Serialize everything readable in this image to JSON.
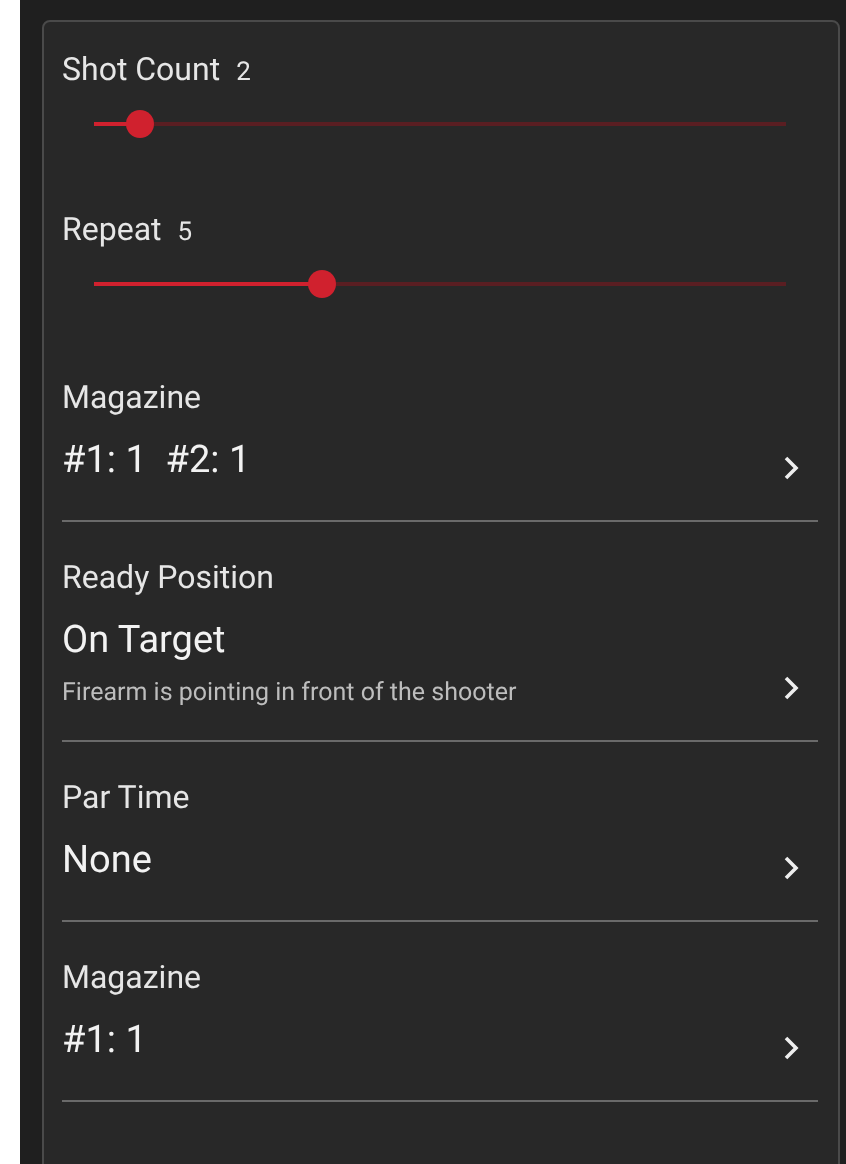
{
  "settings": [
    {
      "kind": "slider",
      "label": "Shot Count",
      "reading": "2",
      "level": 0.066
    },
    {
      "kind": "slider",
      "label": "Repeat",
      "reading": "5",
      "level": 0.33
    },
    {
      "kind": "select",
      "label": "Magazine",
      "value": "#1: 1  #2: 1"
    },
    {
      "kind": "select",
      "label": "Ready Position",
      "value": "On Target",
      "description": "Firearm is pointing in front of the shooter"
    },
    {
      "kind": "select",
      "label": "Par Time",
      "value": "None"
    },
    {
      "kind": "select",
      "label": "Magazine",
      "value": "#1: 1"
    }
  ]
}
